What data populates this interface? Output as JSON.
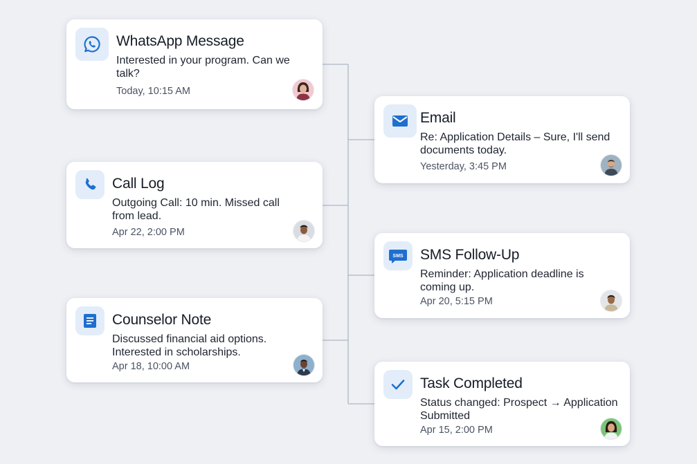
{
  "colors": {
    "background": "#eef0f4",
    "icon_tile": "#e3edf9",
    "accent_blue": "#1f6fcf",
    "connector": "#aeb7c4"
  },
  "cards": {
    "whatsapp": {
      "icon": "whatsapp-icon",
      "title": "WhatsApp Message",
      "body": "Interested in your program. Can we talk?",
      "time": "Today, 10:15 AM",
      "avatar": "woman-avatar"
    },
    "email": {
      "icon": "envelope-icon",
      "title": "Email",
      "body": "Re: Application Details – Sure, I'll send documents today.",
      "time": "Yesterday, 3:45 PM",
      "avatar": "man-avatar"
    },
    "call": {
      "icon": "phone-icon",
      "title": "Call Log",
      "body": "Outgoing Call: 10 min. Missed call from lead.",
      "time": "Apr 22, 2:00 PM",
      "avatar": "man-avatar"
    },
    "sms": {
      "icon": "sms-icon",
      "icon_text": "SMS",
      "title": "SMS Follow-Up",
      "body": "Reminder: Application deadline is coming up.",
      "time": "Apr 20, 5:15 PM",
      "avatar": "man-avatar"
    },
    "note": {
      "icon": "document-icon",
      "title": "Counselor Note",
      "body": "Discussed financial aid options. Interested in scholarships.",
      "time": "Apr 18, 10:00 AM",
      "avatar": "man-avatar"
    },
    "task": {
      "icon": "checkmark-icon",
      "title": "Task Completed",
      "body": "Status changed: Prospect → Application Submitted",
      "time": "Apr 15, 2:00 PM",
      "avatar": "woman-avatar"
    }
  }
}
